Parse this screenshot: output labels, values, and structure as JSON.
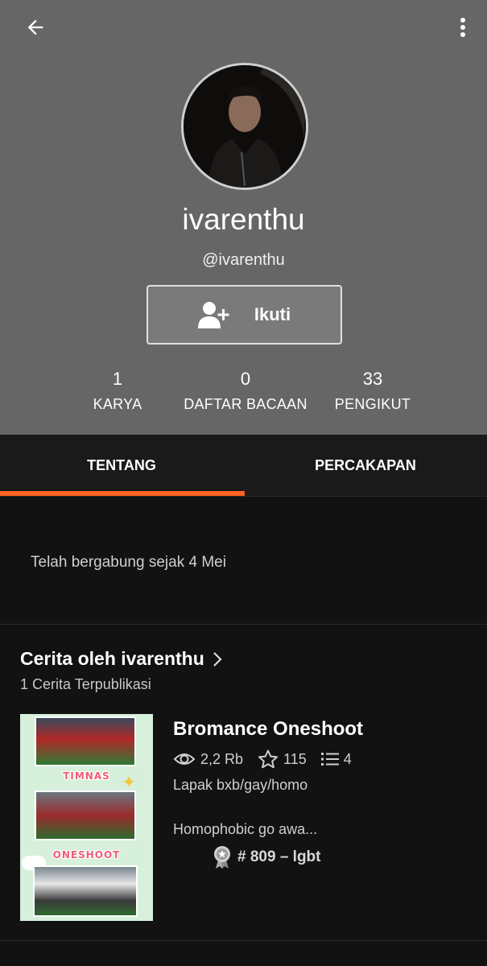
{
  "profile": {
    "display_name": "ivarenthu",
    "handle": "@ivarenthu",
    "follow_label": "Ikuti"
  },
  "stats": [
    {
      "value": "1",
      "label": "KARYA"
    },
    {
      "value": "0",
      "label": "DAFTAR BACAAN"
    },
    {
      "value": "33",
      "label": "PENGIKUT"
    }
  ],
  "tabs": [
    {
      "label": "TENTANG",
      "active": true
    },
    {
      "label": "PERCAKAPAN",
      "active": false
    }
  ],
  "about": {
    "joined": "Telah bergabung sejak 4 Mei"
  },
  "stories_section": {
    "title": "Cerita oleh ivarenthu",
    "subtitle": "1 Cerita Terpublikasi",
    "story": {
      "title": "Bromance Oneshoot",
      "reads": "2,2 Rb",
      "votes": "115",
      "parts": "4",
      "tags": "Lapak bxb/gay/homo",
      "description": "Homophobic go awa...",
      "rank": "# 809 – lgbt",
      "cover_text_1": "TIMNAS",
      "cover_text_2": "ONESHOOT"
    }
  },
  "colors": {
    "header_bg": "#666666",
    "body_bg": "#121212",
    "accent": "#ff6122"
  },
  "icons": [
    "arrow-back-icon",
    "more-vert-icon",
    "person-add-icon",
    "chevron-right-icon",
    "eye-icon",
    "star-icon",
    "list-icon",
    "badge-icon"
  ]
}
